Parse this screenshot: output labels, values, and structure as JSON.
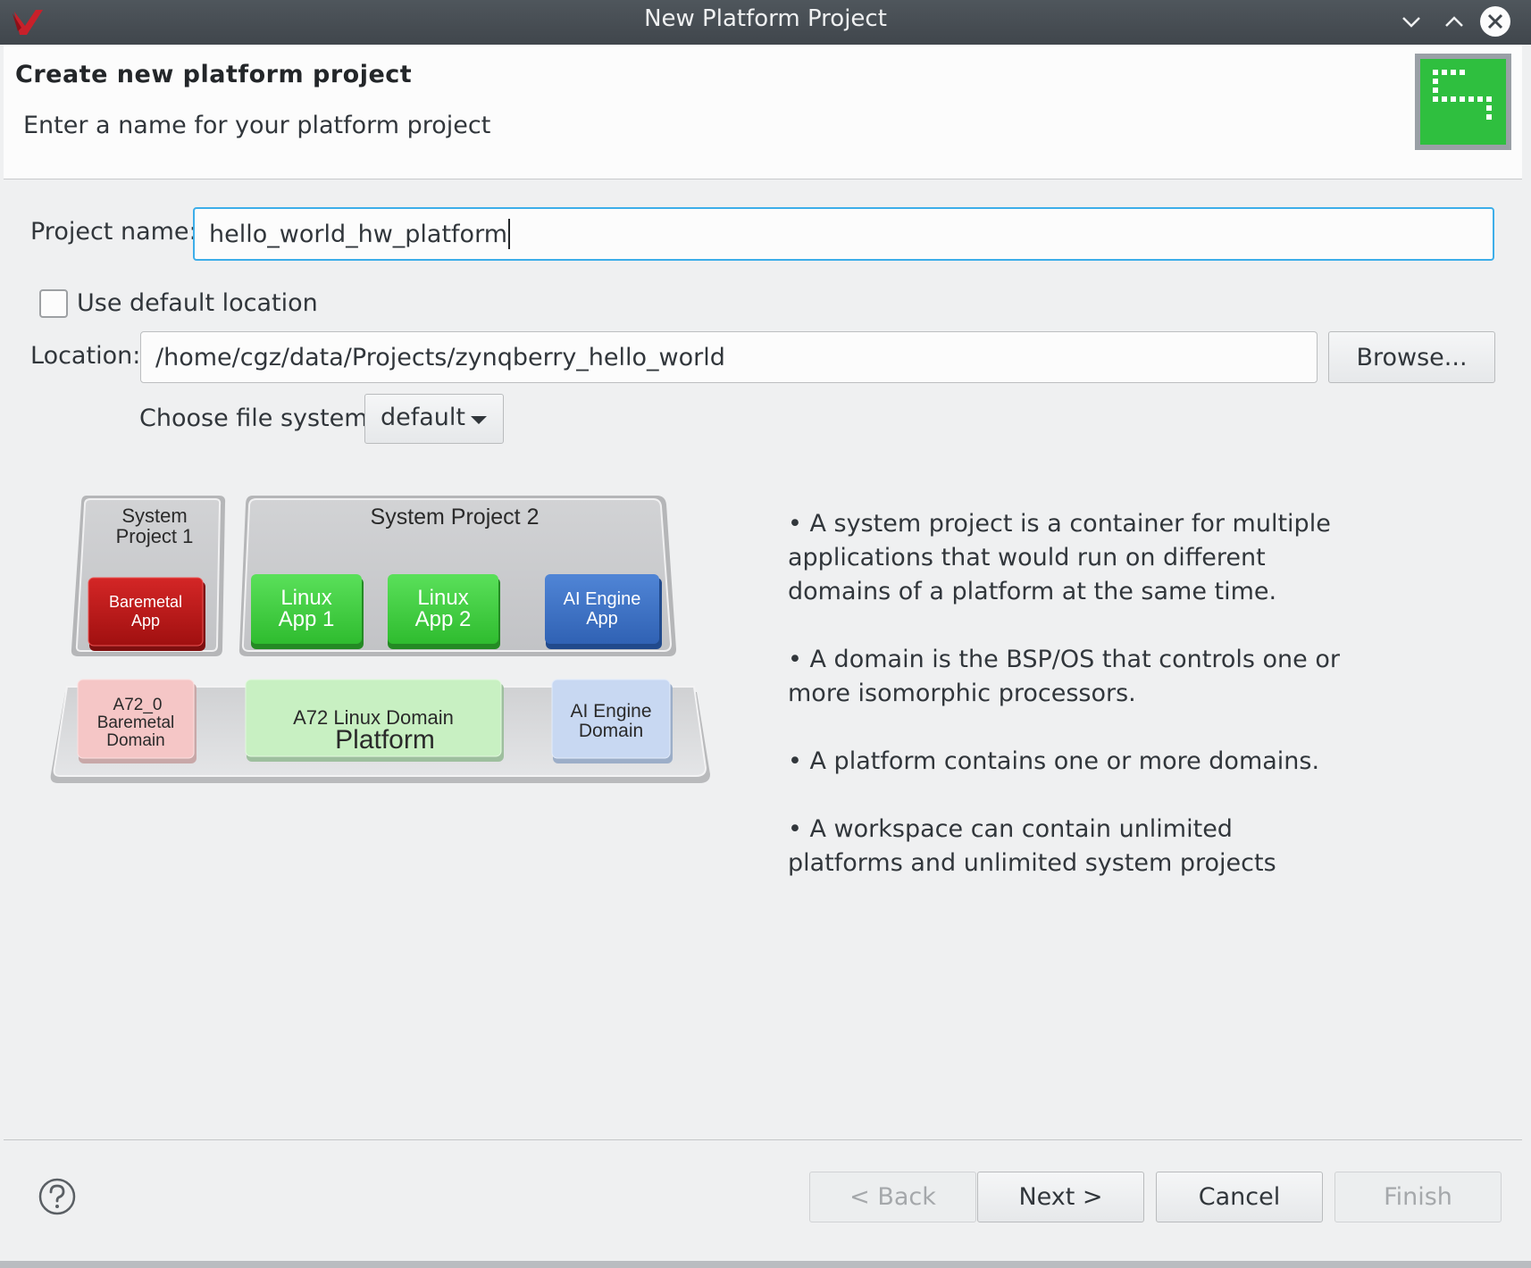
{
  "window": {
    "title": "New Platform Project"
  },
  "banner": {
    "heading": "Create new platform project",
    "subheading": "Enter a name for your platform project"
  },
  "form": {
    "project_name_label": "Project name:",
    "project_name_value": "hello_world_hw_platform",
    "use_default_location_label": "Use default location",
    "use_default_location_checked": false,
    "location_label": "Location:",
    "location_value": "/home/cgz/data/Projects/zynqberry_hello_world",
    "browse_label": "Browse...",
    "file_system_label": "Choose file system:",
    "file_system_value": "default"
  },
  "diagram": {
    "system_project_1_line1": "System",
    "system_project_1_line2": "Project 1",
    "system_project_2": "System Project 2",
    "baremetal_app_line1": "Baremetal",
    "baremetal_app_line2": "App",
    "linux_app1_line1": "Linux",
    "linux_app1_line2": "App 1",
    "linux_app2_line1": "Linux",
    "linux_app2_line2": "App 2",
    "ai_engine_app_line1": "AI Engine",
    "ai_engine_app_line2": "App",
    "a72_baremetal_line1": "A72_0",
    "a72_baremetal_line2": "Baremetal",
    "a72_baremetal_line3": "Domain",
    "a72_linux_domain": "A72 Linux Domain",
    "ai_engine_domain_line1": "AI Engine",
    "ai_engine_domain_line2": "Domain",
    "platform": "Platform"
  },
  "info": {
    "bullets": [
      "• A system project is a container for multiple applications that would run on different domains of a platform at the same time.",
      "• A domain is the BSP/OS that controls one or more isomorphic processors.",
      "• A platform contains one or more domains.",
      "• A workspace can contain unlimited platforms and unlimited system projects"
    ]
  },
  "footer": {
    "back_label": "< Back",
    "next_label": "Next >",
    "cancel_label": "Cancel",
    "finish_label": "Finish"
  },
  "colors": {
    "focus_border": "#3daee9",
    "badge_green": "#2fbf3f",
    "baremetal_red": "#c01a1a",
    "linux_green": "#3fd33f",
    "ai_blue": "#3c72c6"
  }
}
